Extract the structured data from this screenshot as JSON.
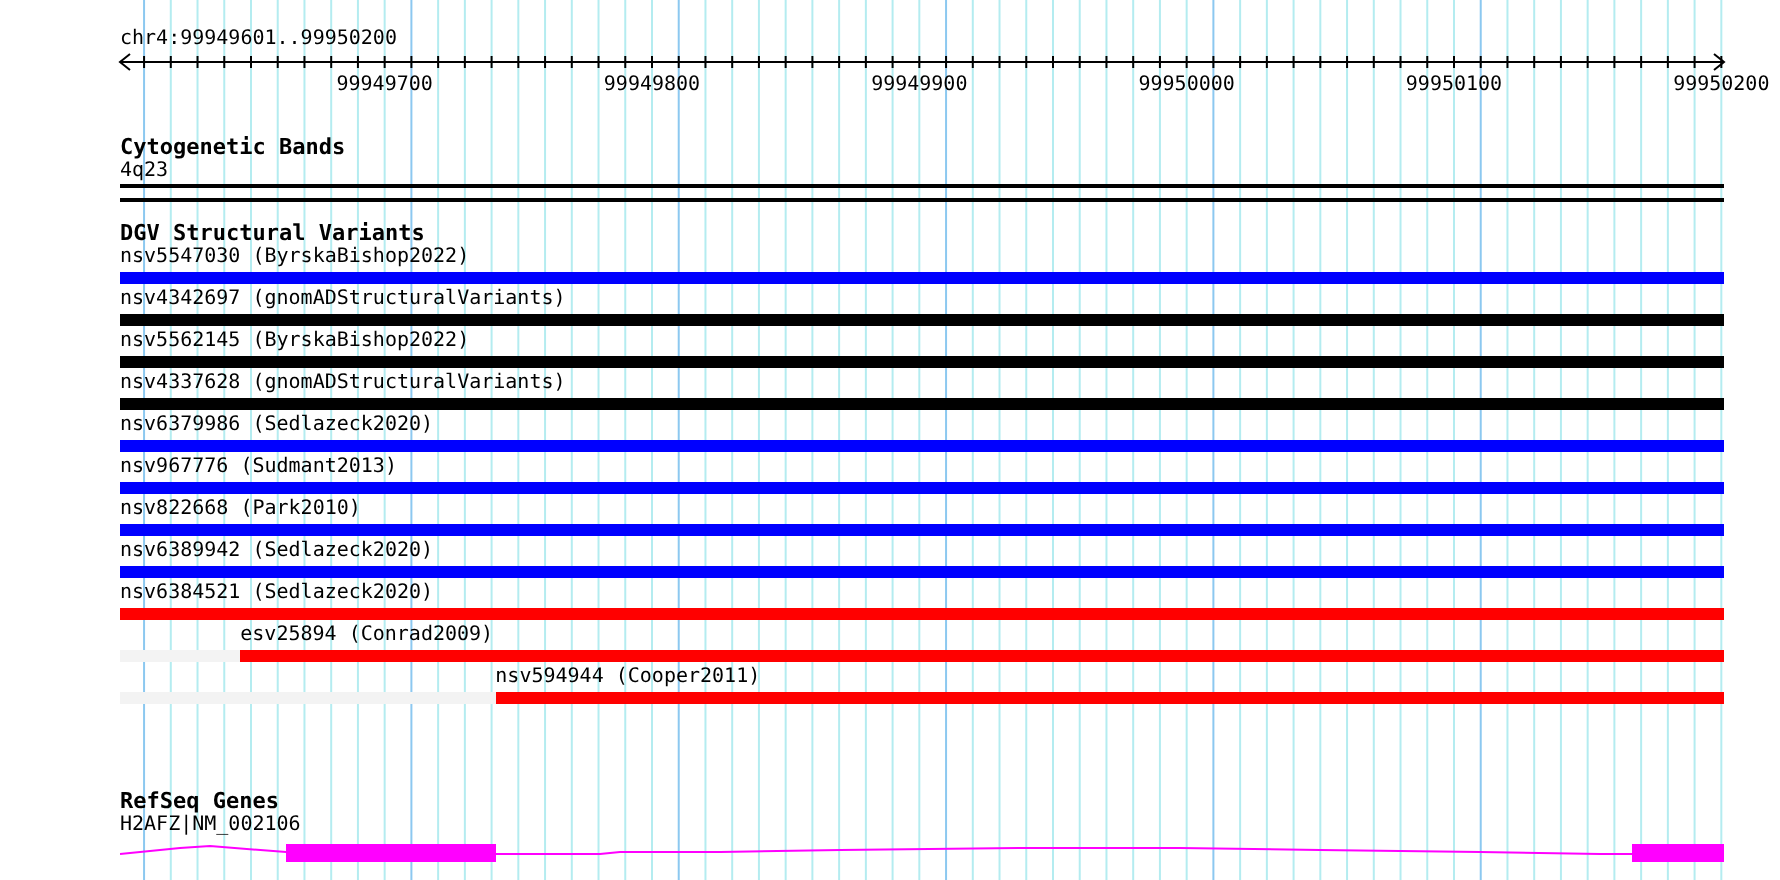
{
  "position": "chr4:99949601..99950200",
  "ruler": {
    "labels": [
      "99949700",
      "99949800",
      "99949900",
      "99950000",
      "99950100",
      "99950200"
    ]
  },
  "tracks": [
    {
      "kind": "cytoband",
      "title": "Cytogenetic Bands",
      "items": [
        {
          "label": "4q23"
        }
      ]
    },
    {
      "kind": "variants",
      "title": "DGV Structural Variants",
      "items": [
        {
          "label": "nsv5547030 (ByrskaBishop2022)",
          "color": "#0000ff",
          "level": 1
        },
        {
          "label": "nsv4342697 (gnomADStructuralVariants)",
          "color": "#000000",
          "level": 1
        },
        {
          "label": "nsv5562145 (ByrskaBishop2022)",
          "color": "#000000",
          "level": 1
        },
        {
          "label": "nsv4337628 (gnomADStructuralVariants)",
          "color": "#000000",
          "level": 1
        },
        {
          "label": "nsv6379986 (Sedlazeck2020)",
          "color": "#0000ff",
          "level": 1
        },
        {
          "label": "nsv967776 (Sudmant2013)",
          "color": "#0000ff",
          "level": 1
        },
        {
          "label": "nsv822668 (Park2010)",
          "color": "#0000ff",
          "level": 1
        },
        {
          "label": "nsv6389942 (Sedlazeck2020)",
          "color": "#0000ff",
          "level": 1
        },
        {
          "label": "nsv6384521 (Sedlazeck2020)",
          "color": "#ff0000",
          "level": 1
        },
        {
          "label": "esv25894 (Conrad2009)",
          "color": "#ff0000",
          "level": 0.925
        },
        {
          "label": "nsv594944 (Cooper2011)",
          "color": "#ff0000",
          "level": 0.766
        }
      ]
    },
    {
      "kind": "gene",
      "title": "RefSeq Genes",
      "items": [
        {
          "label": "H2AFZ|NM_002106"
        }
      ]
    }
  ]
}
